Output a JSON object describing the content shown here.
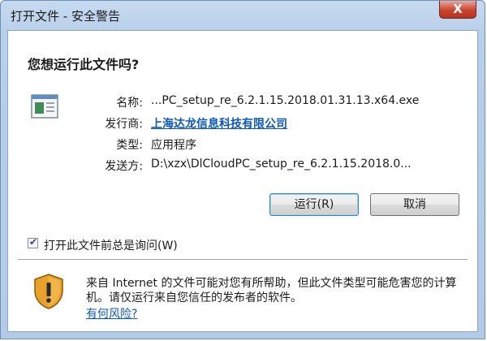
{
  "window": {
    "title": "打开文件 - 安全警告",
    "close_label": "X"
  },
  "dialog": {
    "heading": "您想运行此文件吗?",
    "fields": {
      "name_label": "名称:",
      "name_value": "...PC_setup_re_6.2.1.15.2018.01.31.13.x64.exe",
      "publisher_label": "发行商:",
      "publisher_value": "上海达龙信息科技有限公司",
      "type_label": "类型:",
      "type_value": "应用程序",
      "from_label": "发送方:",
      "from_value": "D:\\xzx\\DlCloudPC_setup_re_6.2.1.15.2018.0..."
    },
    "buttons": {
      "run": "运行(R)",
      "cancel": "取消"
    },
    "checkbox": {
      "label": "打开此文件前总是询问(W)",
      "checked": true
    },
    "warning": {
      "text": "来自 Internet 的文件可能对您有所帮助，但此文件类型可能危害您的计算机。请仅运行来自您信任的发布者的软件。",
      "link": "有何风险?"
    }
  },
  "colors": {
    "link": "#0c58b8",
    "title_bar": "#b9cfe9",
    "close_button": "#c9442f"
  },
  "icons": [
    "application-icon",
    "security-shield-icon",
    "close-icon",
    "checkmark-icon"
  ]
}
